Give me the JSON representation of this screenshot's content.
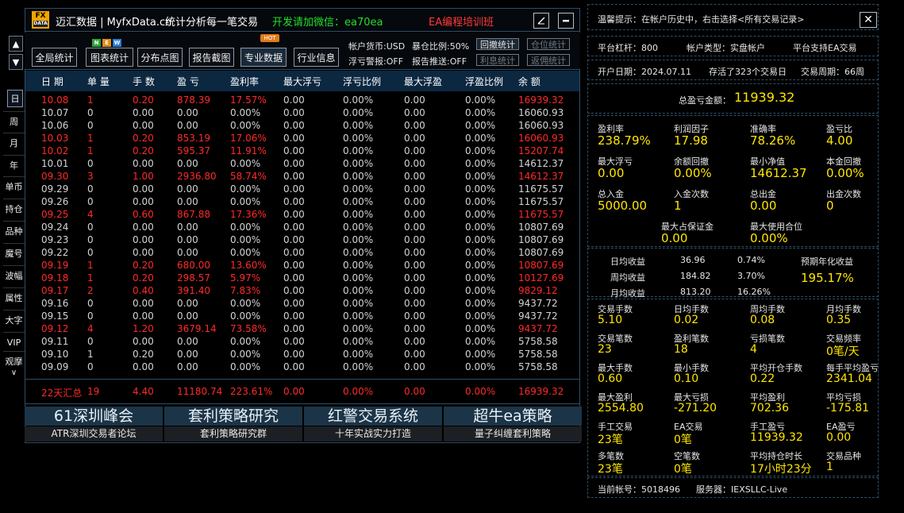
{
  "title": {
    "brand": "迈汇数据 | MyfxData.cn",
    "subtitle": "统计分析每一笔交易",
    "wechat": "开发请加微信：ea70ea",
    "training": "EA编程培训班",
    "logo_top": "FX",
    "logo_bottom": "DATA",
    "colors": {
      "wechat": "#22e02a",
      "training": "#ff3a3a",
      "logo": "#f2a400"
    }
  },
  "side": {
    "arrow_up": "▲",
    "arrow_down": "▼",
    "tabs": [
      "日",
      "周",
      "月",
      "年",
      "单币",
      "持仓",
      "品种",
      "魔号",
      "波幅",
      "属性",
      "大字",
      "VIP",
      "观摩"
    ],
    "selected": 0,
    "expand": "∨"
  },
  "toolbar": {
    "buttons": [
      "全局统计",
      "图表统计",
      "分布点图",
      "报告截图",
      "专业数据",
      "行业信息"
    ],
    "selected": 4,
    "new_badges": [
      "N",
      "E",
      "W"
    ],
    "hot": "HOT",
    "currency": "帐户货币:USD",
    "exposure": "暴仓比例:50%",
    "float_alert": "浮亏警报:OFF",
    "report_push": "报告推送:OFF",
    "small_buttons": [
      {
        "label": "回撤统计",
        "state": "on"
      },
      {
        "label": "仓位统计",
        "state": "off"
      },
      {
        "label": "利息统计",
        "state": "off"
      },
      {
        "label": "返佣统计",
        "state": "off"
      }
    ]
  },
  "table": {
    "headers": [
      "日 期",
      "单 量",
      "手 数",
      "盈 亏",
      "盈利率",
      "最大浮亏",
      "浮亏比例",
      "最大浮盈",
      "浮盈比例",
      "余 额"
    ],
    "rows": [
      [
        "10.08",
        "1",
        "0.20",
        "878.39",
        "17.57%",
        "0.00",
        "0.00%",
        "0.00",
        "0.00%",
        "16939.32"
      ],
      [
        "10.07",
        "0",
        "0.00",
        "0.00",
        "0.00%",
        "0.00",
        "0.00%",
        "0.00",
        "0.00%",
        "16060.93"
      ],
      [
        "10.06",
        "0",
        "0.00",
        "0.00",
        "0.00%",
        "0.00",
        "0.00%",
        "0.00",
        "0.00%",
        "16060.93"
      ],
      [
        "10.03",
        "1",
        "0.20",
        "853.19",
        "17.06%",
        "0.00",
        "0.00%",
        "0.00",
        "0.00%",
        "16060.93"
      ],
      [
        "10.02",
        "1",
        "0.20",
        "595.37",
        "11.91%",
        "0.00",
        "0.00%",
        "0.00",
        "0.00%",
        "15207.74"
      ],
      [
        "10.01",
        "0",
        "0.00",
        "0.00",
        "0.00%",
        "0.00",
        "0.00%",
        "0.00",
        "0.00%",
        "14612.37"
      ],
      [
        "09.30",
        "3",
        "1.00",
        "2936.80",
        "58.74%",
        "0.00",
        "0.00%",
        "0.00",
        "0.00%",
        "14612.37"
      ],
      [
        "09.29",
        "0",
        "0.00",
        "0.00",
        "0.00%",
        "0.00",
        "0.00%",
        "0.00",
        "0.00%",
        "11675.57"
      ],
      [
        "09.26",
        "0",
        "0.00",
        "0.00",
        "0.00%",
        "0.00",
        "0.00%",
        "0.00",
        "0.00%",
        "11675.57"
      ],
      [
        "09.25",
        "4",
        "0.60",
        "867.88",
        "17.36%",
        "0.00",
        "0.00%",
        "0.00",
        "0.00%",
        "11675.57"
      ],
      [
        "09.24",
        "0",
        "0.00",
        "0.00",
        "0.00%",
        "0.00",
        "0.00%",
        "0.00",
        "0.00%",
        "10807.69"
      ],
      [
        "09.23",
        "0",
        "0.00",
        "0.00",
        "0.00%",
        "0.00",
        "0.00%",
        "0.00",
        "0.00%",
        "10807.69"
      ],
      [
        "09.22",
        "0",
        "0.00",
        "0.00",
        "0.00%",
        "0.00",
        "0.00%",
        "0.00",
        "0.00%",
        "10807.69"
      ],
      [
        "09.19",
        "1",
        "0.20",
        "680.00",
        "13.60%",
        "0.00",
        "0.00%",
        "0.00",
        "0.00%",
        "10807.69"
      ],
      [
        "09.18",
        "1",
        "0.20",
        "298.57",
        "5.97%",
        "0.00",
        "0.00%",
        "0.00",
        "0.00%",
        "10127.69"
      ],
      [
        "09.17",
        "2",
        "0.40",
        "391.40",
        "7.83%",
        "0.00",
        "0.00%",
        "0.00",
        "0.00%",
        "9829.12"
      ],
      [
        "09.16",
        "0",
        "0.00",
        "0.00",
        "0.00%",
        "0.00",
        "0.00%",
        "0.00",
        "0.00%",
        "9437.72"
      ],
      [
        "09.15",
        "0",
        "0.00",
        "0.00",
        "0.00%",
        "0.00",
        "0.00%",
        "0.00",
        "0.00%",
        "9437.72"
      ],
      [
        "09.12",
        "4",
        "1.20",
        "3679.14",
        "73.58%",
        "0.00",
        "0.00%",
        "0.00",
        "0.00%",
        "9437.72"
      ],
      [
        "09.11",
        "0",
        "0.00",
        "0.00",
        "0.00%",
        "0.00",
        "0.00%",
        "0.00",
        "0.00%",
        "5758.58"
      ],
      [
        "09.10",
        "1",
        "0.20",
        "0.00",
        "0.00%",
        "0.00",
        "0.00%",
        "0.00",
        "0.00%",
        "5758.58"
      ],
      [
        "09.09",
        "0",
        "0.00",
        "0.00",
        "0.00%",
        "0.00",
        "0.00%",
        "0.00",
        "0.00%",
        "5758.58"
      ]
    ],
    "highlighted_rows": [
      0,
      3,
      4,
      6,
      9,
      13,
      14,
      15,
      18
    ],
    "summary": [
      "22天汇总",
      "19",
      "4.40",
      "11180.74",
      "223.61%",
      "0.00",
      "0.00%",
      "0.00",
      "0.00%",
      "16939.32"
    ],
    "colors": {
      "profit": "#ff2a2a",
      "flat": "#d4d4d4",
      "header_bg": "#0c2740"
    }
  },
  "banners": [
    {
      "title": "61深圳峰会",
      "sub": "ATR深圳交易者论坛"
    },
    {
      "title": "套利策略研究",
      "sub": "套利策略研究群"
    },
    {
      "title": "红警交易系统",
      "sub": "十年实战实力打造"
    },
    {
      "title": "超牛ea策略",
      "sub": "量子纠缠套利策略"
    }
  ],
  "right": {
    "tip": "温馨提示：在帐户历史中，右击选择<所有交易记录>",
    "close": "✕",
    "leverage": "平台杠杆：800",
    "account_type": "帐户类型：实盘帐户",
    "ea_support": "平台支持EA交易",
    "open_date": "开户日期：2024.07.11",
    "alive": "存活了323个交易日",
    "cycle": "交易周期：66周",
    "total_pl_label": "总盈亏金额：",
    "total_pl_value": "11939.32",
    "stats1": [
      {
        "label": "盈利率",
        "value": "238.79%"
      },
      {
        "label": "利润因子",
        "value": "17.98"
      },
      {
        "label": "准确率",
        "value": "78.26%"
      },
      {
        "label": "盈亏比",
        "value": "4.00"
      },
      {
        "label": "最大浮亏",
        "value": "0.00"
      },
      {
        "label": "余额回撤",
        "value": "0.00%"
      },
      {
        "label": "最小净值",
        "value": "14612.37"
      },
      {
        "label": "本金回撤",
        "value": "0.00%"
      },
      {
        "label": "总入金",
        "value": "5000.00"
      },
      {
        "label": "入金次数",
        "value": "1"
      },
      {
        "label": "总出金",
        "value": "0.00"
      },
      {
        "label": "出金次数",
        "value": "0"
      }
    ],
    "margin": [
      {
        "label": "最大占保证金",
        "value": "0.00"
      },
      {
        "label": "最大使用合位",
        "value": "0.00%"
      }
    ],
    "returns": [
      {
        "label": "日均收益",
        "amount": "36.96",
        "pct": "0.74%"
      },
      {
        "label": "周均收益",
        "amount": "184.82",
        "pct": "3.70%"
      },
      {
        "label": "月均收益",
        "amount": "813.20",
        "pct": "16.26%"
      }
    ],
    "annual_label": "预期年化收益",
    "annual_value": "195.17%",
    "stats2": [
      {
        "label": "交易手数",
        "value": "5.10"
      },
      {
        "label": "日均手数",
        "value": "0.02"
      },
      {
        "label": "周均手数",
        "value": "0.08"
      },
      {
        "label": "月均手数",
        "value": "0.35"
      },
      {
        "label": "交易笔数",
        "value": "23"
      },
      {
        "label": "盈利笔数",
        "value": "18"
      },
      {
        "label": "亏损笔数",
        "value": "4"
      },
      {
        "label": "交易频率",
        "value": "0笔/天"
      },
      {
        "label": "最大手数",
        "value": "0.60"
      },
      {
        "label": "最小手数",
        "value": "0.10"
      },
      {
        "label": "平均开仓手数",
        "value": "0.22"
      },
      {
        "label": "每手平均盈亏",
        "value": "2341.04"
      },
      {
        "label": "最大盈利",
        "value": "2554.80"
      },
      {
        "label": "最大亏损",
        "value": "-271.20"
      },
      {
        "label": "平均盈利",
        "value": "702.36"
      },
      {
        "label": "平均亏损",
        "value": "-175.81"
      },
      {
        "label": "手工交易",
        "value": "23笔"
      },
      {
        "label": "EA交易",
        "value": "0笔"
      },
      {
        "label": "手工盈亏",
        "value": "11939.32"
      },
      {
        "label": "EA盈亏",
        "value": "0.00"
      },
      {
        "label": "多笔数",
        "value": "23笔"
      },
      {
        "label": "空笔数",
        "value": "0笔"
      },
      {
        "label": "平均持仓时长",
        "value": "17小时23分"
      },
      {
        "label": "交易品种",
        "value": "1"
      }
    ],
    "account": "当前帐号：5018496",
    "server": "服务器：IEXSLLC-Live",
    "colors": {
      "value": "#ffe600"
    }
  }
}
